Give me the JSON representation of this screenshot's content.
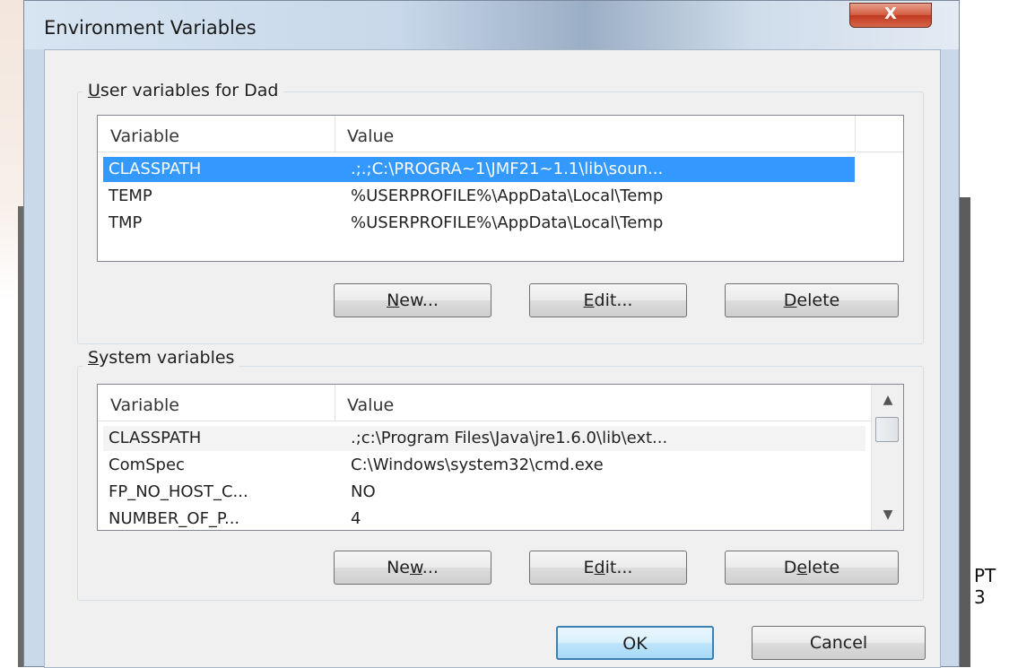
{
  "window": {
    "title": "Environment Variables",
    "close_label": "X"
  },
  "user_vars": {
    "group_label": "User variables for Dad",
    "columns": [
      "Variable",
      "Value"
    ],
    "rows": [
      {
        "name": "CLASSPATH",
        "value": ".;.;C:\\PROGRA~1\\JMF21~1.1\\lib\\soun...",
        "selected": true
      },
      {
        "name": "TEMP",
        "value": "%USERPROFILE%\\AppData\\Local\\Temp"
      },
      {
        "name": "TMP",
        "value": "%USERPROFILE%\\AppData\\Local\\Temp"
      }
    ],
    "buttons": {
      "new": "New...",
      "edit": "Edit...",
      "delete": "Delete"
    }
  },
  "system_vars": {
    "group_label": "System variables",
    "columns": [
      "Variable",
      "Value"
    ],
    "rows": [
      {
        "name": "CLASSPATH",
        "value": ".;c:\\Program Files\\Java\\jre1.6.0\\lib\\ext..."
      },
      {
        "name": "ComSpec",
        "value": "C:\\Windows\\system32\\cmd.exe"
      },
      {
        "name": "FP_NO_HOST_C...",
        "value": "NO"
      },
      {
        "name": "NUMBER_OF_P...",
        "value": "4"
      }
    ],
    "buttons": {
      "new": "New...",
      "edit": "Edit...",
      "delete": "Delete"
    }
  },
  "footer": {
    "ok": "OK",
    "cancel": "Cancel"
  },
  "background_text": "PT 3"
}
